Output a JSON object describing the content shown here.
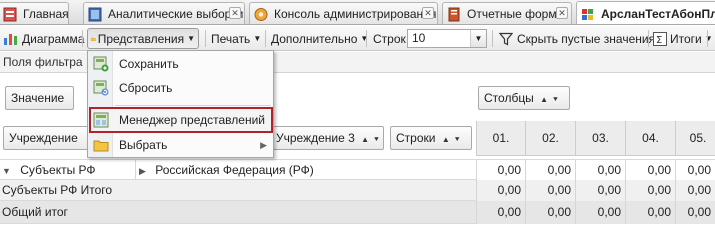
{
  "tabs": [
    {
      "label": "Главная",
      "icon": "home-icon"
    },
    {
      "label": "Аналитические выборки",
      "icon": "cube-icon"
    },
    {
      "label": "Консоль администрирования",
      "icon": "gear-icon"
    },
    {
      "label": "Отчетные формы",
      "icon": "report-icon"
    },
    {
      "label": "АрсланТестАбонПл",
      "icon": "logo-icon"
    }
  ],
  "toolbar": {
    "chart_label": "Диаграмма",
    "views_label": "Представления",
    "print_label": "Печать",
    "more_label": "Дополнительно",
    "rows_label": "Строк",
    "rows_value": "10",
    "hide_empty_label": "Скрыть пустые значения",
    "totals_label": "Итоги"
  },
  "filter_bar": {
    "label": "Поля фильтра"
  },
  "pivot": {
    "value_field": "Значение",
    "columns_field": "Столбцы",
    "row_fields": [
      "Учреждение",
      "Учреждение 3",
      "Строки"
    ],
    "column_headers": [
      "01.",
      "02.",
      "03.",
      "04.",
      "05."
    ],
    "rows": [
      {
        "label": "Субъекты РФ",
        "sublabel": "Российская Федерация (РФ)",
        "values": [
          "0,00",
          "0,00",
          "0,00",
          "0,00",
          "0,00"
        ]
      },
      {
        "label": "Субъекты РФ Итого",
        "values": [
          "0,00",
          "0,00",
          "0,00",
          "0,00",
          "0,00"
        ]
      },
      {
        "label": "Общий итог",
        "values": [
          "0,00",
          "0,00",
          "0,00",
          "0,00",
          "0,00"
        ]
      }
    ]
  },
  "menu": {
    "items": [
      {
        "label": "Сохранить",
        "icon": "save-view-icon"
      },
      {
        "label": "Сбросить",
        "icon": "reset-view-icon"
      },
      {
        "label": "Менеджер представлений",
        "icon": "view-manager-icon"
      },
      {
        "label": "Выбрать",
        "icon": "folder-icon"
      }
    ]
  },
  "colors": {
    "highlight_border": "#b3212b",
    "toolbar_bg": "#eeeeee"
  }
}
